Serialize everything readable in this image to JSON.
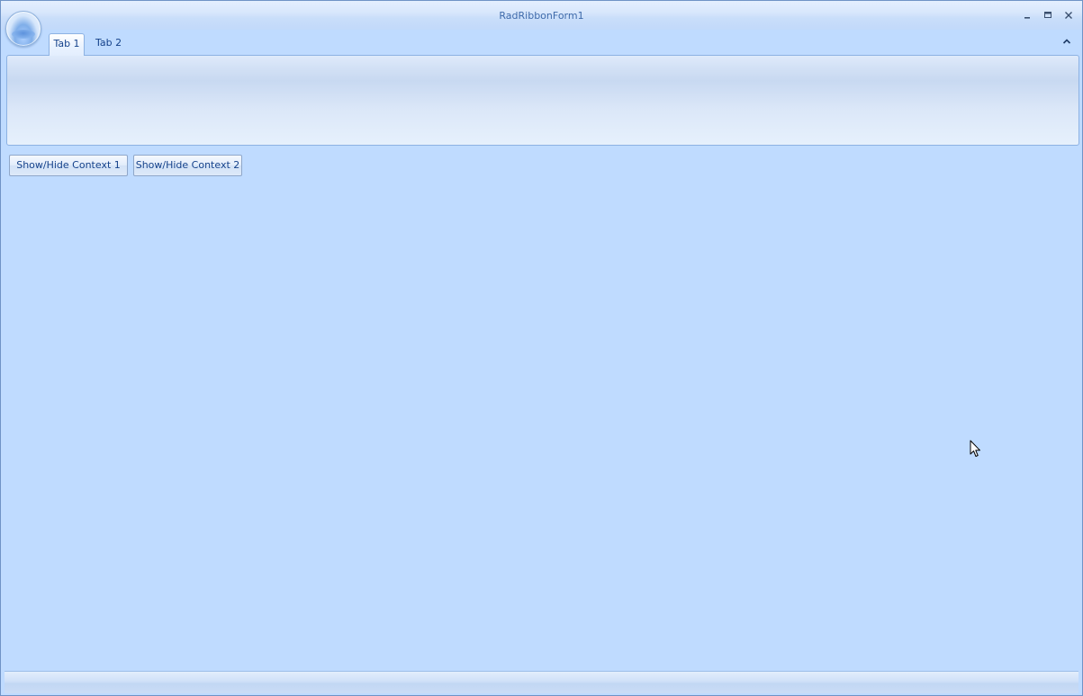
{
  "window": {
    "title": "RadRibbonForm1"
  },
  "icons": {
    "minimize": "minimize-icon",
    "maximize": "maximize-icon",
    "close": "close-icon",
    "collapse": "chevron-up-icon",
    "cursor": "mouse-pointer-icon"
  },
  "ribbon": {
    "tabs": [
      {
        "label": "Tab 1",
        "active": true
      },
      {
        "label": "Tab 2",
        "active": false
      }
    ]
  },
  "buttons": {
    "context1_label": "Show/Hide Context 1",
    "context2_label": "Show/Hide Context 2"
  },
  "colors": {
    "background": "#bfdbff",
    "text": "#15428b",
    "border": "#6f93c6"
  }
}
